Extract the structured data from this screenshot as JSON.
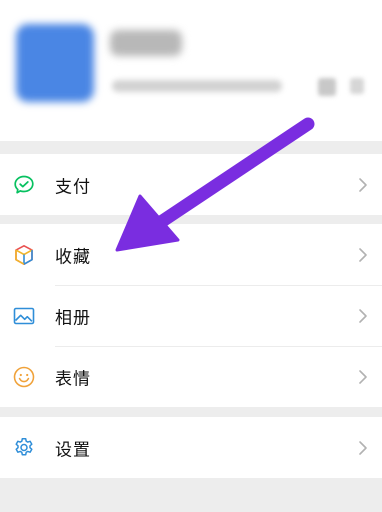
{
  "menu": {
    "pay": {
      "label": "支付",
      "icon": "pay-check-icon"
    },
    "favorites": {
      "label": "收藏",
      "icon": "cube-icon"
    },
    "album": {
      "label": "相册",
      "icon": "image-icon"
    },
    "stickers": {
      "label": "表情",
      "icon": "smiley-icon"
    },
    "settings": {
      "label": "设置",
      "icon": "gear-icon"
    }
  },
  "colors": {
    "pay_green": "#07c160",
    "album_blue": "#2f8ed8",
    "smiley_orange": "#f0a23a",
    "settings_blue": "#2f8ed8",
    "annotation_arrow": "#7a2de0"
  }
}
